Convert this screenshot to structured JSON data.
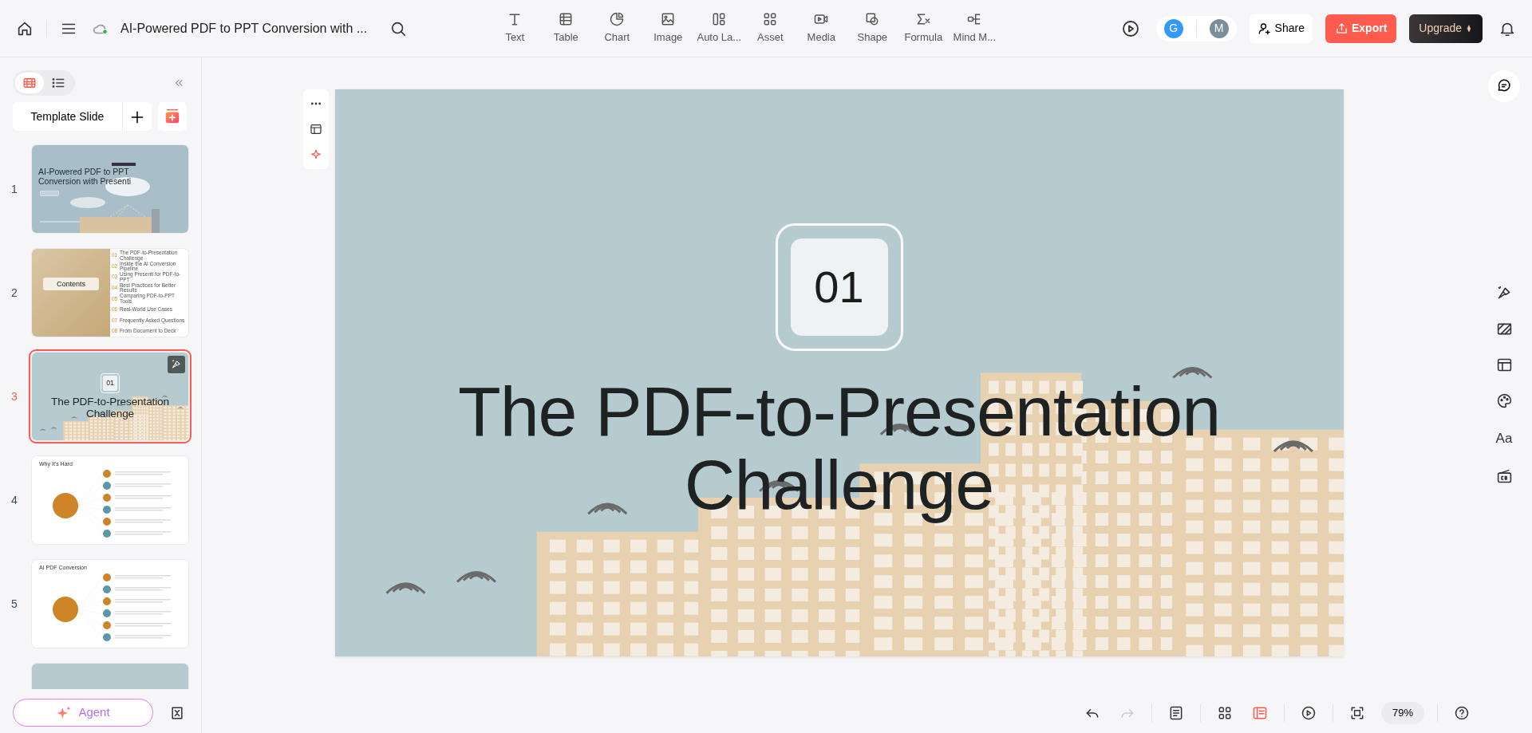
{
  "header": {
    "document_title": "AI-Powered PDF to PPT Conversion with ...",
    "share": "Share",
    "export": "Export",
    "upgrade": "Upgrade"
  },
  "insert_tools": [
    {
      "label": "Text"
    },
    {
      "label": "Table"
    },
    {
      "label": "Chart"
    },
    {
      "label": "Image"
    },
    {
      "label": "Auto La..."
    },
    {
      "label": "Asset"
    },
    {
      "label": "Media"
    },
    {
      "label": "Shape"
    },
    {
      "label": "Formula"
    },
    {
      "label": "Mind M..."
    }
  ],
  "collaborators": [
    {
      "initial": "G",
      "color": "#3399ff"
    },
    {
      "initial": "M",
      "color": "#7a8d99"
    }
  ],
  "sidebar": {
    "view_tabs": [
      {
        "kind": "filmstrip",
        "selected": true
      },
      {
        "kind": "outline",
        "selected": false
      }
    ],
    "template_button": "Template Slide",
    "slides": [
      {
        "number": "1",
        "kind": "cover",
        "title": "AI-Powered PDF to PPT Conversion with Presenti",
        "selected": false
      },
      {
        "number": "2",
        "kind": "contents",
        "title": "Contents",
        "items": [
          {
            "number": "01",
            "text": "The PDF-to-Presentation Challenge"
          },
          {
            "number": "02",
            "text": "Inside the AI Conversion Pipeline"
          },
          {
            "number": "03",
            "text": "Using Presenti for PDF-to-PPT"
          },
          {
            "number": "04",
            "text": "Best Practices for Better Results"
          },
          {
            "number": "05",
            "text": "Comparing PDF-to-PPT Tools"
          },
          {
            "number": "06",
            "text": "Real-World Use Cases"
          },
          {
            "number": "07",
            "text": "Frequently Asked Questions"
          },
          {
            "number": "08",
            "text": "From Document to Deck"
          }
        ],
        "selected": false
      },
      {
        "number": "3",
        "kind": "section",
        "badge": "01",
        "title": "The PDF-to-Presentation Challenge",
        "selected": true
      },
      {
        "number": "4",
        "kind": "diagram",
        "title": "Why It's Hard",
        "selected": false
      },
      {
        "number": "5",
        "kind": "diagram",
        "title": "AI PDF Conversion",
        "selected": false
      },
      {
        "kind": "partial",
        "selected": false
      }
    ],
    "agent_button": "Agent"
  },
  "canvas": {
    "badge": "01",
    "title": "The PDF-to-Presentation Challenge"
  },
  "side_panel": {
    "font_label": "Aa"
  },
  "bottom_bar": {
    "view_modes": [
      {
        "kind": "grid",
        "selected": false
      },
      {
        "kind": "single",
        "selected": true
      }
    ],
    "zoom": "79%"
  }
}
